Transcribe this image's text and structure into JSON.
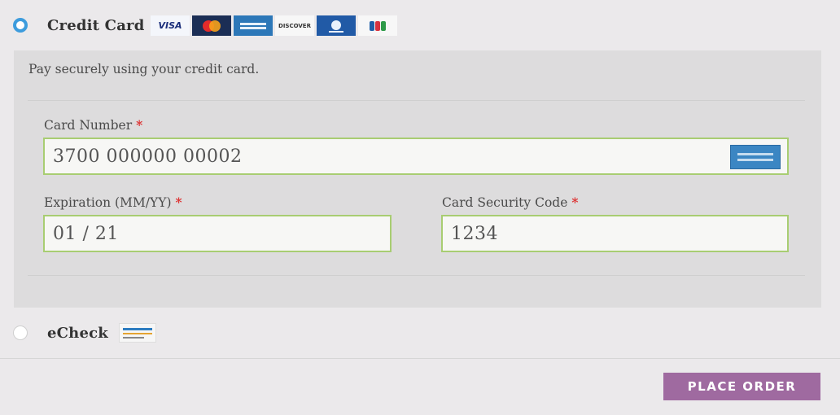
{
  "payment_methods": {
    "credit_card": {
      "label": "Credit Card",
      "selected": true,
      "card_logos": [
        "visa-logo",
        "mastercard-logo",
        "amex-logo",
        "discover-logo",
        "diners-club-logo",
        "jcb-logo"
      ],
      "visa_text": "VISA",
      "discover_text": "DISCOVER"
    },
    "echeck": {
      "label": "eCheck",
      "selected": false
    }
  },
  "form": {
    "description": "Pay securely using your credit card.",
    "card_number_label": "Card Number",
    "card_number_value": "3700 000000 00002",
    "expiration_label": "Expiration (MM/YY)",
    "expiration_value": "01 / 21",
    "security_code_label": "Card Security Code",
    "security_code_value": "1234",
    "required_mark": "*"
  },
  "actions": {
    "place_order_label": "PLACE ORDER"
  },
  "colors": {
    "accent": "#3d9cdd",
    "button": "#9f6aa0",
    "input_border": "#a8cd72",
    "required": "#dd3333"
  }
}
